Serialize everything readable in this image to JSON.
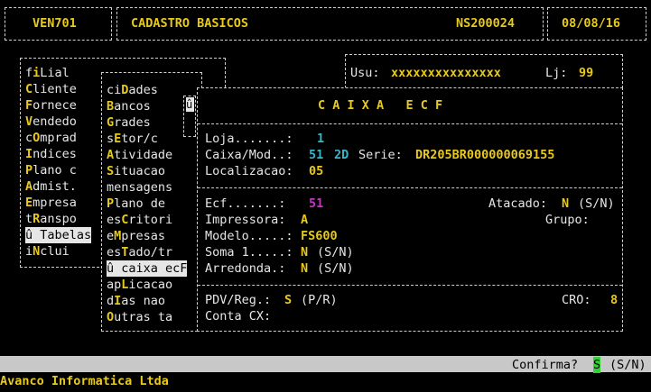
{
  "header": {
    "program_code": "VEN701",
    "screen_title": "CADASTRO BASICOS",
    "terminal_id": "NS200024",
    "date": "08/08/16"
  },
  "user_bar": {
    "user_label": "Usu:",
    "user_value": "xxxxxxxxxxxxxxx",
    "store_label": "Lj:",
    "store_value": "99"
  },
  "main_menu": {
    "items": [
      {
        "pre": "f",
        "hot": "i",
        "post": "Lial"
      },
      {
        "pre": "",
        "hot": "C",
        "post": "liente"
      },
      {
        "pre": "",
        "hot": "F",
        "post": "ornece"
      },
      {
        "pre": "",
        "hot": "V",
        "post": "endedo"
      },
      {
        "pre": "c",
        "hot": "O",
        "post": "mprad"
      },
      {
        "pre": "",
        "hot": "I",
        "post": "ndices"
      },
      {
        "pre": "",
        "hot": "P",
        "post": "lano c"
      },
      {
        "pre": "",
        "hot": "A",
        "post": "dmist."
      },
      {
        "pre": "",
        "hot": "E",
        "post": "mpresa"
      },
      {
        "pre": "t",
        "hot": "R",
        "post": "anspo"
      },
      {
        "pre": "û ",
        "hot": "",
        "post": "Tabelas"
      },
      {
        "pre": "i",
        "hot": "N",
        "post": "clui"
      }
    ]
  },
  "sub_menu": {
    "arrow_glyph": "û",
    "items": [
      {
        "pre": "ci",
        "hot": "D",
        "post": "ades"
      },
      {
        "pre": "",
        "hot": "B",
        "post": "ancos"
      },
      {
        "pre": "",
        "hot": "G",
        "post": "rades"
      },
      {
        "pre": "s",
        "hot": "E",
        "post": "tor/c"
      },
      {
        "pre": "",
        "hot": "A",
        "post": "tividade"
      },
      {
        "pre": "",
        "hot": "S",
        "post": "ituacao"
      },
      {
        "pre": "",
        "hot": "",
        "post": "mensagens"
      },
      {
        "pre": "",
        "hot": "P",
        "post": "lano de"
      },
      {
        "pre": "es",
        "hot": "C",
        "post": "ritori"
      },
      {
        "pre": "e",
        "hot": "M",
        "post": "presas"
      },
      {
        "pre": "es",
        "hot": "T",
        "post": "ado/tr"
      },
      {
        "pre": "û caixa ec",
        "hot": "",
        "post": "F"
      },
      {
        "pre": "ap",
        "hot": "L",
        "post": "icacao"
      },
      {
        "pre": "d",
        "hot": "I",
        "post": "as nao"
      },
      {
        "pre": "",
        "hot": "O",
        "post": "utras ta"
      }
    ]
  },
  "form": {
    "title": "C A I X A   E C F",
    "loja_label": "Loja.......:",
    "loja_value": "1",
    "caixa_label": "Caixa/Mod..:",
    "caixa_value": "51",
    "mod_value": "2D",
    "serie_label": "Serie:",
    "serie_value": "DR205BR000000069155",
    "localizacao_label": "Localizacao:",
    "localizacao_value": "05",
    "ecf_label": "Ecf.......:",
    "ecf_value": "51",
    "atacado_label": "Atacado:",
    "atacado_value": "N",
    "atacado_hint": "(S/N)",
    "impressora_label": "Impressora:",
    "impressora_value": "A",
    "grupo_label": "Grupo:",
    "modelo_label": "Modelo.....:",
    "modelo_value": "FS600",
    "soma_label": "Soma 1.....:",
    "soma_value": "N",
    "soma_hint": "(S/N)",
    "arredonda_label": "Arredonda.:",
    "arredonda_value": "N",
    "arredonda_hint": "(S/N)",
    "pdv_label": "PDV/Reg.:",
    "pdv_value": "S",
    "pdv_hint": "(P/R)",
    "cro_label": "CRO:",
    "cro_value": "8",
    "conta_label": "Conta CX:"
  },
  "status_bar": {
    "prompt": "Confirma?",
    "value": "S",
    "hint": "(S/N)"
  },
  "footer": {
    "company": "Avanco Informatica Ltda"
  },
  "colors": {
    "yellow": "#e8c91e",
    "cyan": "#35b8c9",
    "magenta": "#c436c4",
    "cursor_green": "#35d035",
    "status_gray": "#c8c8c8"
  }
}
